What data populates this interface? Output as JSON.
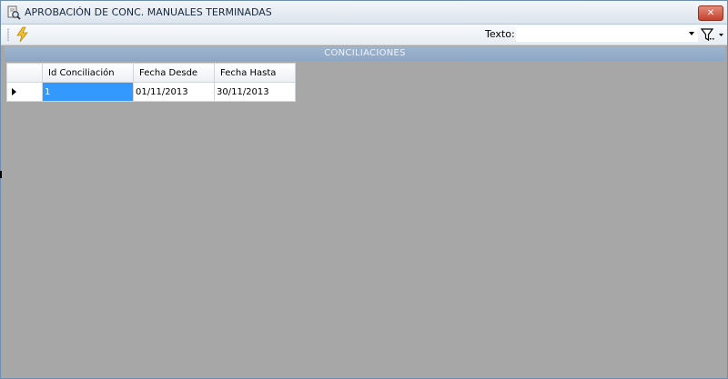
{
  "window": {
    "title": "APROBACIÓN DE CONC. MANUALES TERMINADAS",
    "close_icon": "close-icon",
    "app_icon": "document-search-icon"
  },
  "toolbar": {
    "action_icon": "lightning-icon",
    "search_label": "Texto:",
    "search_value": "",
    "filter_icon": "filter-icon"
  },
  "section": {
    "title": "CONCILIACIONES"
  },
  "grid": {
    "columns": [
      "Id Conciliación",
      "Fecha Desde",
      "Fecha Hasta"
    ],
    "rows": [
      {
        "id": "1",
        "fecha_desde": "01/11/2013",
        "fecha_hasta": "30/11/2013",
        "selected": true
      }
    ]
  },
  "colors": {
    "accent": "#3399ff",
    "section_header": "#94abc9",
    "background": "#a7a7a7"
  }
}
